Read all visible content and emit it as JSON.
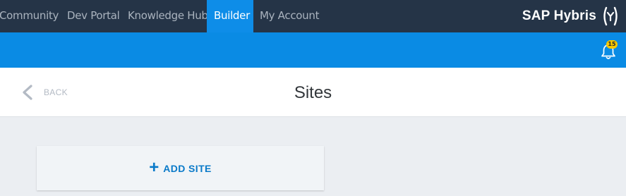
{
  "topnav": {
    "tabs": [
      {
        "label": "Community"
      },
      {
        "label": "Dev Portal"
      },
      {
        "label": "Knowledge Hub"
      },
      {
        "label": "Builder",
        "active": true
      },
      {
        "label": "My Account"
      }
    ],
    "brand": "SAP Hybris"
  },
  "notifications": {
    "count": "15",
    "icon": "bell-icon"
  },
  "header": {
    "back_label": "BACK",
    "title": "Sites"
  },
  "main": {
    "add_site_label": "ADD SITE",
    "add_icon": "plus-icon"
  },
  "colors": {
    "nav_bg": "#253447",
    "accent_blue": "#0a8be4",
    "badge": "#f7c800",
    "link_blue": "#0a7ac9"
  }
}
